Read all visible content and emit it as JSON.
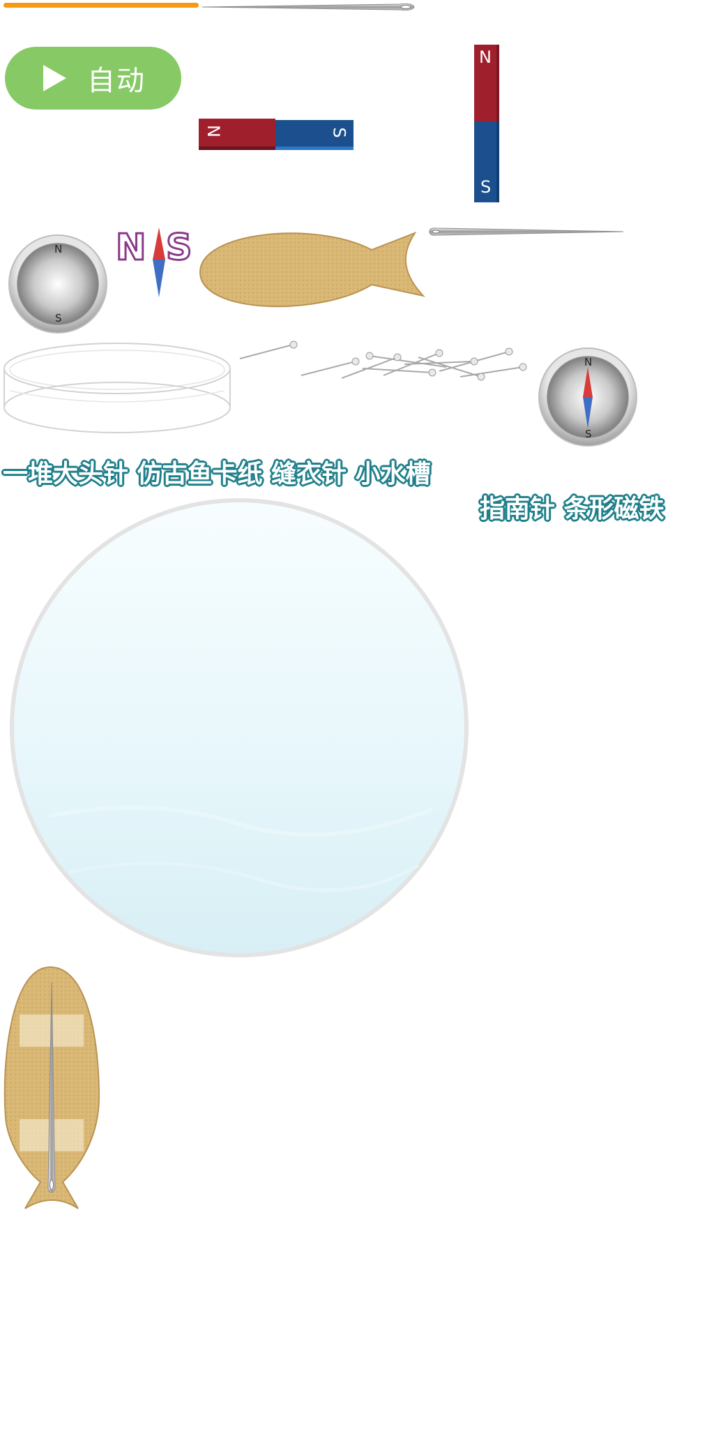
{
  "progress": {
    "value": 1
  },
  "toolbar": {
    "auto_label": "自动"
  },
  "magnets": {
    "north": "N",
    "south": "S"
  },
  "compass": {
    "north": "N",
    "south": "S"
  },
  "captions": {
    "line1": "一堆大头针 仿古鱼卡纸 缝衣针 小水槽",
    "line2": "指南针 条形磁铁"
  },
  "colors": {
    "progress": "#f59a12",
    "auto_button": "#86c965",
    "magnet_north": "#9f1f2c",
    "magnet_south": "#1b4f8d",
    "caption_outline": "#1f7f8a",
    "card": "#d9b775"
  },
  "icons": {
    "auto_button": "play-icon"
  }
}
